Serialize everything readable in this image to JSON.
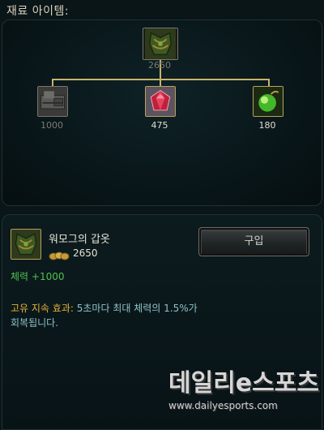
{
  "section": {
    "title": "재료 아이템:"
  },
  "tree": {
    "root": {
      "name": "워모그의 갑옷",
      "price": "2650"
    },
    "components": [
      {
        "price": "1000",
        "icon": "giants-belt-icon",
        "owned": true
      },
      {
        "price": "475",
        "icon": "ruby-crystal-icon",
        "owned": false
      },
      {
        "price": "180",
        "icon": "rejuvenation-bead-icon",
        "owned": false
      }
    ]
  },
  "detail": {
    "item_name": "워모그의 갑옷",
    "cost": "2650",
    "buy_label": "구입",
    "stat": "체력 +1000",
    "passive_label": "고유 지속 효과:",
    "passive_text_line1": "5초마다 최대 체력의 1.5%가",
    "passive_text_line2": "회복됩니다."
  },
  "colors": {
    "gold_border": "#b8a15a",
    "stat_green": "#4fc24f",
    "passive_gold": "#e3b23c",
    "passive_text": "#8fc2c5"
  },
  "watermark": {
    "line1": "데일리e스포츠",
    "line2": "www.dailyesports.com"
  }
}
